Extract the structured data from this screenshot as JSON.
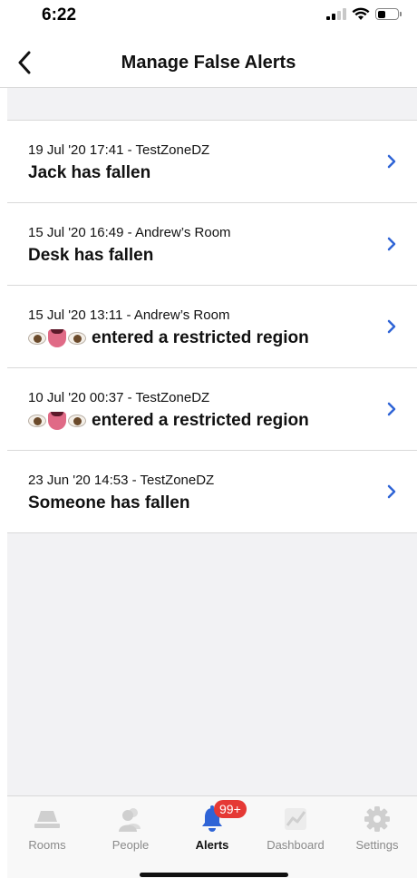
{
  "status_bar": {
    "time": "6:22"
  },
  "nav": {
    "title": "Manage False Alerts",
    "back_icon": "chevron-left-icon"
  },
  "alerts": [
    {
      "meta": "19 Jul '20 17:41 - TestZoneDZ",
      "subject": "",
      "title": "Jack has fallen",
      "has_emoji": false
    },
    {
      "meta": "15 Jul '20 16:49 - Andrew’s Room",
      "subject": "",
      "title": "Desk has fallen",
      "has_emoji": false
    },
    {
      "meta": "15 Jul '20 13:11 - Andrew’s Room",
      "subject": "👁👅👁",
      "title": "entered a restricted region",
      "has_emoji": true
    },
    {
      "meta": "10 Jul '20 00:37 - TestZoneDZ",
      "subject": "👁👅👁",
      "title": "entered a restricted region",
      "has_emoji": true
    },
    {
      "meta": "23 Jun '20 14:53 - TestZoneDZ",
      "subject": "",
      "title": "Someone has fallen",
      "has_emoji": false
    }
  ],
  "tabs": [
    {
      "label": "Rooms",
      "icon": "rooms-icon",
      "active": false
    },
    {
      "label": "People",
      "icon": "people-icon",
      "active": false
    },
    {
      "label": "Alerts",
      "icon": "bell-icon",
      "active": true,
      "badge": "99+"
    },
    {
      "label": "Dashboard",
      "icon": "chart-icon",
      "active": false
    },
    {
      "label": "Settings",
      "icon": "gear-icon",
      "active": false
    }
  ],
  "colors": {
    "accent": "#2f64d6",
    "badge": "#e53935",
    "inactive_icon": "#cfcfcf",
    "background": "#f2f2f4"
  }
}
